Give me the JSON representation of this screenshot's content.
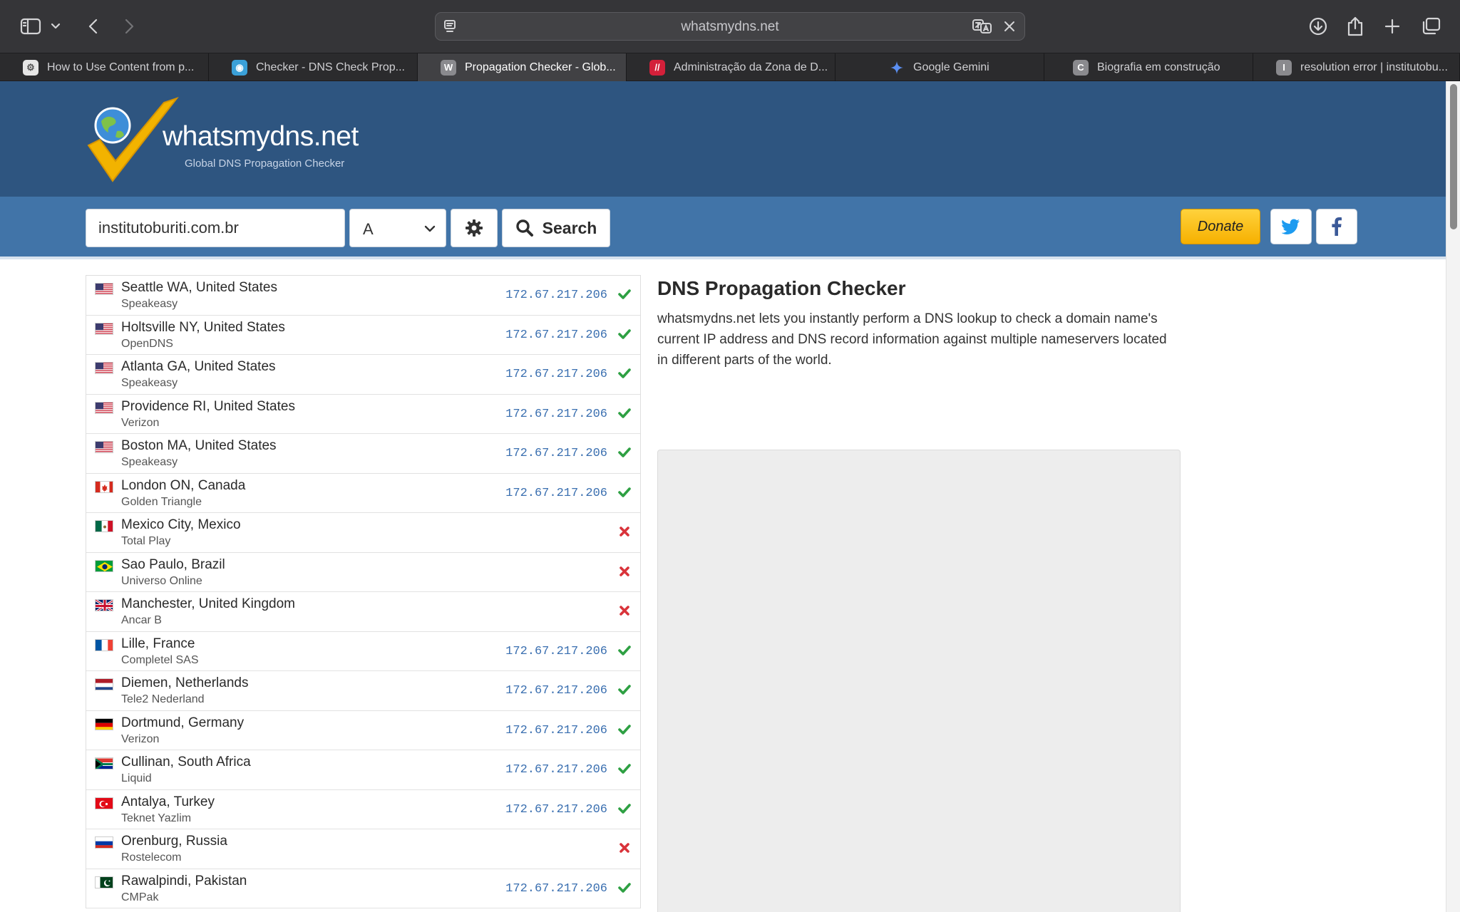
{
  "browser": {
    "url": "whatsmydns.net",
    "tabs": [
      {
        "label": "How to Use Content from p...",
        "fav": "gear-favicon",
        "fav_color": "#777777",
        "active": false
      },
      {
        "label": "Checker - DNS Check Prop...",
        "fav": "pin-favicon",
        "fav_color": "#3aa0d8",
        "active": false
      },
      {
        "label": "Propagation Checker - Glob...",
        "fav": "W",
        "fav_color": "#8a8a8e",
        "active": true
      },
      {
        "label": "Administração da Zona de D...",
        "fav": "stripes-favicon",
        "fav_color": "#d3203a",
        "active": false
      },
      {
        "label": "Google Gemini",
        "fav": "gemini-star-favicon",
        "fav_color": "#4a8cf0",
        "active": false
      },
      {
        "label": "Biografia em construção",
        "fav": "C",
        "fav_color": "#8a8a8e",
        "active": false
      },
      {
        "label": "resolution error | institutobu...",
        "fav": "I",
        "fav_color": "#8a8a8e",
        "active": false
      }
    ]
  },
  "site": {
    "name": "whatsmydns.net",
    "tagline": "Global DNS Propagation Checker",
    "search": {
      "domain_value": "institutoburiti.com.br",
      "record_type": "A",
      "search_label": "Search",
      "donate_label": "Donate"
    }
  },
  "results": [
    {
      "location": "Seattle WA, United States",
      "provider": "Speakeasy",
      "ip": "172.67.217.206",
      "ok": true,
      "flag": "us"
    },
    {
      "location": "Holtsville NY, United States",
      "provider": "OpenDNS",
      "ip": "172.67.217.206",
      "ok": true,
      "flag": "us"
    },
    {
      "location": "Atlanta GA, United States",
      "provider": "Speakeasy",
      "ip": "172.67.217.206",
      "ok": true,
      "flag": "us"
    },
    {
      "location": "Providence RI, United States",
      "provider": "Verizon",
      "ip": "172.67.217.206",
      "ok": true,
      "flag": "us"
    },
    {
      "location": "Boston MA, United States",
      "provider": "Speakeasy",
      "ip": "172.67.217.206",
      "ok": true,
      "flag": "us"
    },
    {
      "location": "London ON, Canada",
      "provider": "Golden Triangle",
      "ip": "172.67.217.206",
      "ok": true,
      "flag": "ca"
    },
    {
      "location": "Mexico City, Mexico",
      "provider": "Total Play",
      "ip": "",
      "ok": false,
      "flag": "mx"
    },
    {
      "location": "Sao Paulo, Brazil",
      "provider": "Universo Online",
      "ip": "",
      "ok": false,
      "flag": "br"
    },
    {
      "location": "Manchester, United Kingdom",
      "provider": "Ancar B",
      "ip": "",
      "ok": false,
      "flag": "gb"
    },
    {
      "location": "Lille, France",
      "provider": "Completel SAS",
      "ip": "172.67.217.206",
      "ok": true,
      "flag": "fr"
    },
    {
      "location": "Diemen, Netherlands",
      "provider": "Tele2 Nederland",
      "ip": "172.67.217.206",
      "ok": true,
      "flag": "nl"
    },
    {
      "location": "Dortmund, Germany",
      "provider": "Verizon",
      "ip": "172.67.217.206",
      "ok": true,
      "flag": "de"
    },
    {
      "location": "Cullinan, South Africa",
      "provider": "Liquid",
      "ip": "172.67.217.206",
      "ok": true,
      "flag": "za"
    },
    {
      "location": "Antalya, Turkey",
      "provider": "Teknet Yazlim",
      "ip": "172.67.217.206",
      "ok": true,
      "flag": "tr"
    },
    {
      "location": "Orenburg, Russia",
      "provider": "Rostelecom",
      "ip": "",
      "ok": false,
      "flag": "ru"
    },
    {
      "location": "Rawalpindi, Pakistan",
      "provider": "CMPak",
      "ip": "172.67.217.206",
      "ok": true,
      "flag": "pk"
    }
  ],
  "info": {
    "title": "DNS Propagation Checker",
    "text": "whatsmydns.net lets you instantly perform a DNS lookup to check a domain name's current IP address and DNS record information against multiple nameservers located in different parts of the world."
  },
  "colors": {
    "header_bg": "#2e5580",
    "band_bg": "#4174a8",
    "ok": "#2ea043",
    "fail": "#d9333a",
    "ip": "#3a6fb0",
    "donate": "#f6b000"
  }
}
